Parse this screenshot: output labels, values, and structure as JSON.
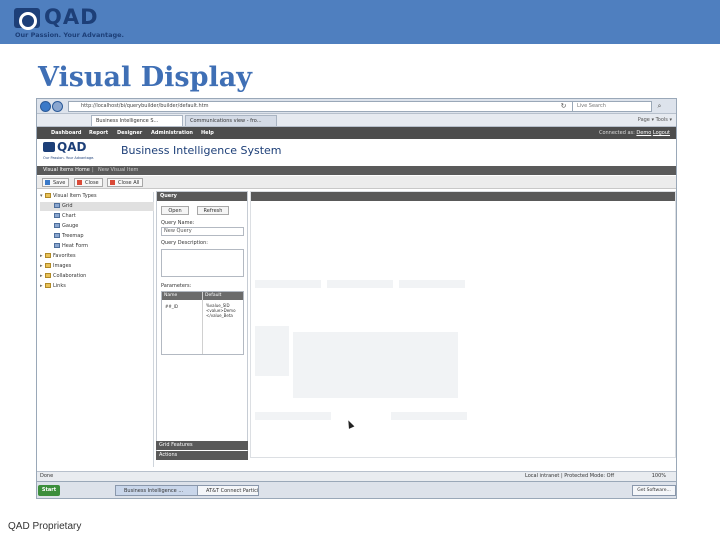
{
  "slide": {
    "logo_text": "QAD",
    "tagline": "Our Passion. Your Advantage.",
    "title": "Visual Display",
    "footer": "QAD Proprietary"
  },
  "browser": {
    "address": "http://localhost/bi/querybuilder/builder/default.htm",
    "search_placeholder": "Live Search",
    "tabs": [
      {
        "label": "Business Intelligence S...",
        "active": true
      },
      {
        "label": "Communications view - fro...",
        "active": false
      }
    ],
    "tab_tools": "Page ▾   Tools ▾"
  },
  "app": {
    "menu": [
      "Dashboard",
      "Report",
      "Designer",
      "Administration",
      "Help"
    ],
    "connected_label": "Connected as:",
    "connected_user": "Demo",
    "logout": "Logout",
    "logo_text": "QAD",
    "logo_tagline": "Our Passion. Your Advantage.",
    "title": "Business Intelligence System",
    "breadcrumb_current": "Visual Items Home",
    "breadcrumb_next": "New Visual Item",
    "toolbar": {
      "save": "Save",
      "close": "Close",
      "close_all": "Close All"
    }
  },
  "tree": {
    "root": "Visual Item Types",
    "items": [
      "Grid",
      "Chart",
      "Gauge",
      "Treemap",
      "Heat Form"
    ],
    "folders": [
      "Favorites",
      "Images",
      "Collaboration",
      "Links"
    ]
  },
  "query": {
    "header": "Query",
    "open_button": "Open",
    "refresh_button": "Refresh",
    "name_label": "Query Name:",
    "name_value": "New Query",
    "description_label": "Query Description:",
    "parameters_label": "Parameters:",
    "param_headers": [
      "Name",
      "Default"
    ],
    "param_name": "##_ID",
    "param_default": "%value_SID\n<value>Demo\n</value_Beta",
    "grid_features": "Grid Features",
    "actions": "Actions"
  },
  "status": {
    "left": "Done",
    "zone": "Local intranet | Protected Mode: Off",
    "zoom": "100%"
  },
  "taskbar": {
    "start": "Start",
    "tasks": [
      "Business Intelligence ...",
      "AT&T Connect Participan..."
    ],
    "tray": "Get Software..."
  }
}
